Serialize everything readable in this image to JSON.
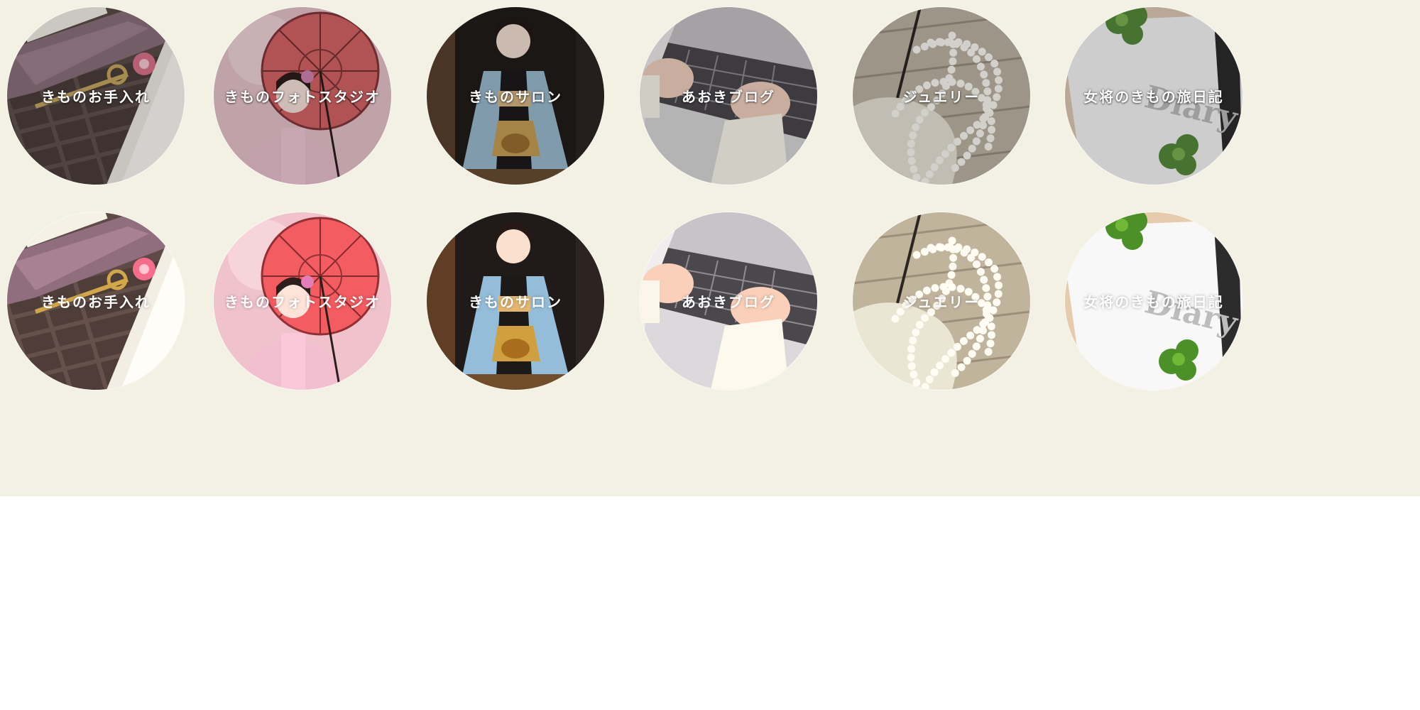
{
  "page": {
    "band_color": "#f3f1e4",
    "background": "#ffffff"
  },
  "rows": [
    {
      "variant": "muted",
      "items": [
        {
          "label": "きものお手入れ",
          "image": "kimono-care-tray-image"
        },
        {
          "label": "きものフォトスタジオ",
          "image": "woman-with-red-parasol-image"
        },
        {
          "label": "きものサロン",
          "image": "kimono-tea-ceremony-image"
        },
        {
          "label": "あおきブログ",
          "image": "laptop-typing-image"
        },
        {
          "label": "ジュエリー",
          "image": "pearl-necklace-image"
        },
        {
          "label": "女将のきもの旅日記",
          "image": "diary-clover-image"
        }
      ]
    },
    {
      "variant": "bright",
      "items": [
        {
          "label": "きものお手入れ",
          "image": "kimono-care-tray-image"
        },
        {
          "label": "きものフォトスタジオ",
          "image": "woman-with-red-parasol-image"
        },
        {
          "label": "きものサロン",
          "image": "kimono-tea-ceremony-image"
        },
        {
          "label": "あおきブログ",
          "image": "laptop-typing-image"
        },
        {
          "label": "ジュエリー",
          "image": "pearl-necklace-image"
        },
        {
          "label": "女将のきもの旅日記",
          "image": "diary-clover-image"
        }
      ]
    }
  ]
}
